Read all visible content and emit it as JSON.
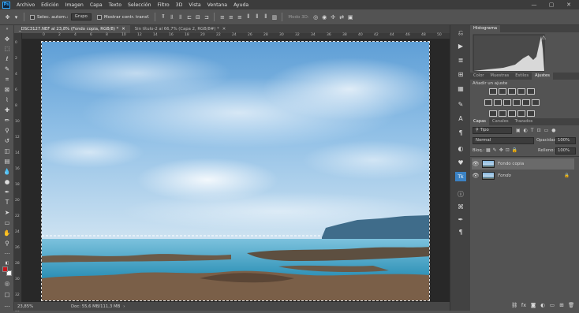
{
  "app": {
    "logo": "Ps"
  },
  "menu": [
    "Archivo",
    "Edición",
    "Imagen",
    "Capa",
    "Texto",
    "Selección",
    "Filtro",
    "3D",
    "Vista",
    "Ventana",
    "Ayuda"
  ],
  "window_controls": [
    "—",
    "▢",
    "✕"
  ],
  "options": {
    "auto_select_label": "Selec. autom.:",
    "group_value": "Grupo",
    "transform_label": "Mostrar contr. transf.",
    "mode_3d_label": "Modo 3D:"
  },
  "document_tabs": [
    {
      "label": "_DSC3127.NEF al 23,8% (Fondo copia, RGB/8) *",
      "close": "✕",
      "active": true
    },
    {
      "label": "Sin título-2 al 66,7% (Capa 2, RGB/8#) *",
      "close": "✕",
      "active": false
    }
  ],
  "status": {
    "zoom": "23,85%",
    "doc": "Doc: 55,6 MB/111,3 MB",
    "arrow": "›"
  },
  "ruler_top": [
    "0",
    "2",
    "4",
    "6",
    "8",
    "10",
    "12",
    "14",
    "16",
    "18",
    "20",
    "22",
    "24",
    "26",
    "28",
    "30",
    "32",
    "34",
    "36",
    "38",
    "40",
    "42",
    "44",
    "46",
    "48",
    "50"
  ],
  "ruler_left": [
    "0",
    "2",
    "4",
    "6",
    "8",
    "10",
    "12",
    "14",
    "16",
    "18",
    "20",
    "22",
    "24",
    "26",
    "28",
    "30",
    "32",
    "34"
  ],
  "histogram": {
    "title": "Histograma",
    "warning": "⚠"
  },
  "adjustments": {
    "tabs": [
      "Color",
      "Muestras",
      "Estilos",
      "Ajustes"
    ],
    "active_tab": "Ajustes",
    "heading": "Añadir un ajuste"
  },
  "layers_panel": {
    "tabs": [
      "Capas",
      "Canales",
      "Trazados"
    ],
    "active_tab": "Capas",
    "filter": "Tipo",
    "blend_mode": "Normal",
    "opacity_label": "Opacidad:",
    "opacity_value": "100%",
    "lock_label": "Bloq.:",
    "fill_label": "Relleno:",
    "fill_value": "100%",
    "layers": [
      {
        "name": "Fondo copia",
        "selected": true
      },
      {
        "name": "Fondo",
        "selected": false
      }
    ],
    "lock_icon": "🔒"
  },
  "colors": {
    "foreground": "#c8161c",
    "background": "#ffffff",
    "accent": "#31a8ff"
  }
}
